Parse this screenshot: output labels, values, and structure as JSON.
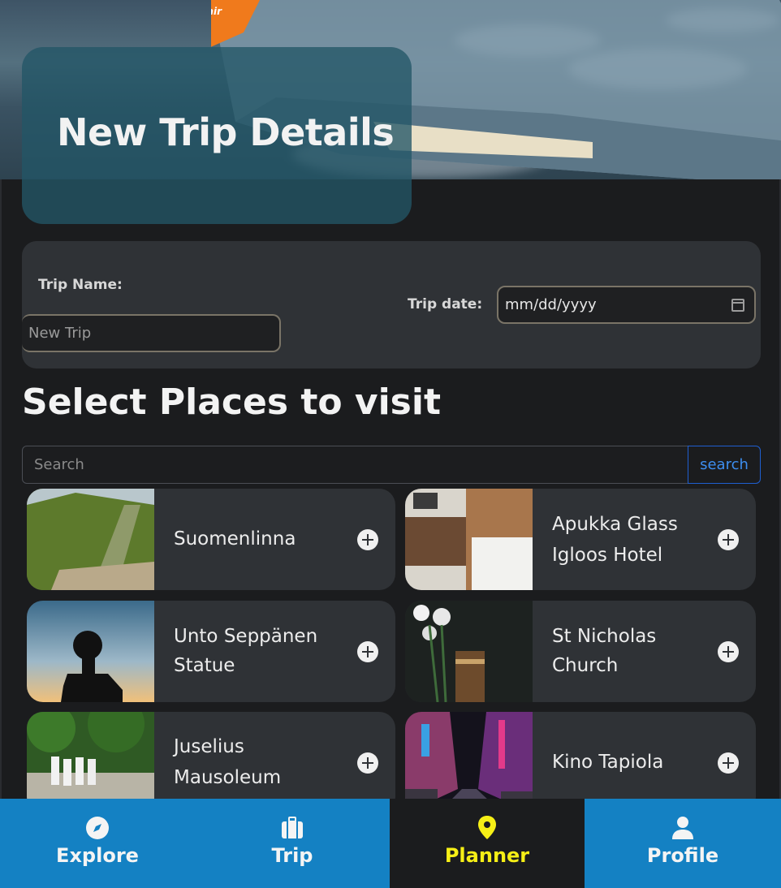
{
  "hero": {
    "title": "New Trip Details",
    "airline_logo_text": "JEJUair"
  },
  "form": {
    "trip_name_label": "Trip Name:",
    "trip_name_placeholder": "New Trip",
    "trip_date_label": "Trip date:",
    "trip_date_value": "mm/dd/yyyy"
  },
  "places_section": {
    "title": "Select Places to visit",
    "search_placeholder": "Search",
    "search_button": "search",
    "places": [
      {
        "name_line1": "Suomenlinna",
        "name_line2": "",
        "thumb_icon": "stairs-hill-photo"
      },
      {
        "name_line1": "Apukka Glass",
        "name_line2": "Igloos Hotel",
        "thumb_icon": "hotel-room-photo"
      },
      {
        "name_line1": "Unto Seppänen",
        "name_line2": "Statue",
        "thumb_icon": "statue-silhouette-photo"
      },
      {
        "name_line1": "St Nicholas",
        "name_line2": "Church",
        "thumb_icon": "flowers-book-photo"
      },
      {
        "name_line1": "Juselius",
        "name_line2": "Mausoleum",
        "thumb_icon": "parade-park-photo"
      },
      {
        "name_line1": "Kino Tapiola",
        "name_line2": "",
        "thumb_icon": "neon-street-photo"
      }
    ]
  },
  "bottom_nav": {
    "items": [
      {
        "label": "Explore",
        "icon": "compass-icon"
      },
      {
        "label": "Trip",
        "icon": "suitcase-icon"
      },
      {
        "label": "Planner",
        "icon": "map-pin-icon",
        "active": true
      },
      {
        "label": "Profile",
        "icon": "person-icon"
      }
    ]
  },
  "colors": {
    "nav_blue": "#1481c3",
    "active_yellow": "#f6ef16",
    "panel": "#2f3236",
    "background": "#1b1c1e"
  }
}
